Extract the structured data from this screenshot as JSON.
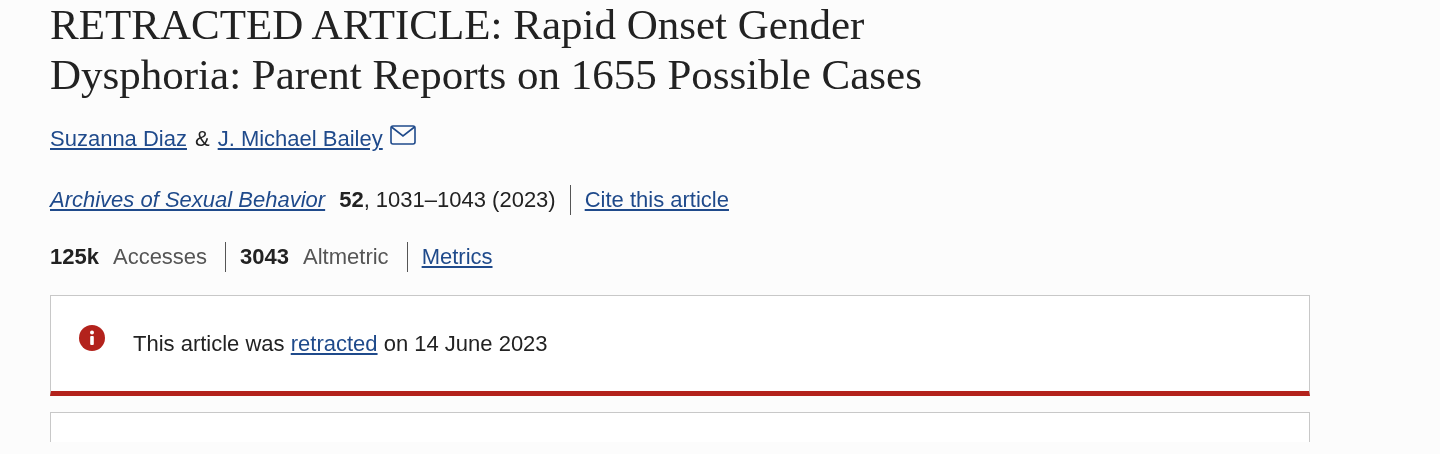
{
  "title_lines": [
    "RETRACTED ARTICLE: Rapid Onset Gender",
    "Dysphoria: Parent Reports on 1655 Possible Cases"
  ],
  "authors": [
    {
      "name": "Suzanna Diaz",
      "email": false
    },
    {
      "name": "J. Michael Bailey",
      "email": true
    }
  ],
  "author_separator": "&",
  "citation": {
    "journal": "Archives of Sexual Behavior",
    "volume": "52",
    "pages": ", 1031–1043 (2023)",
    "cite_link": "Cite this article"
  },
  "metrics": [
    {
      "count": "125k",
      "name": "Accesses"
    },
    {
      "count": "3043",
      "name": "Altmetric"
    }
  ],
  "metrics_link": "Metrics",
  "notice": {
    "kind": "retraction",
    "before": "This article was ",
    "link": "retracted",
    "after": " on 14 June 2023"
  }
}
